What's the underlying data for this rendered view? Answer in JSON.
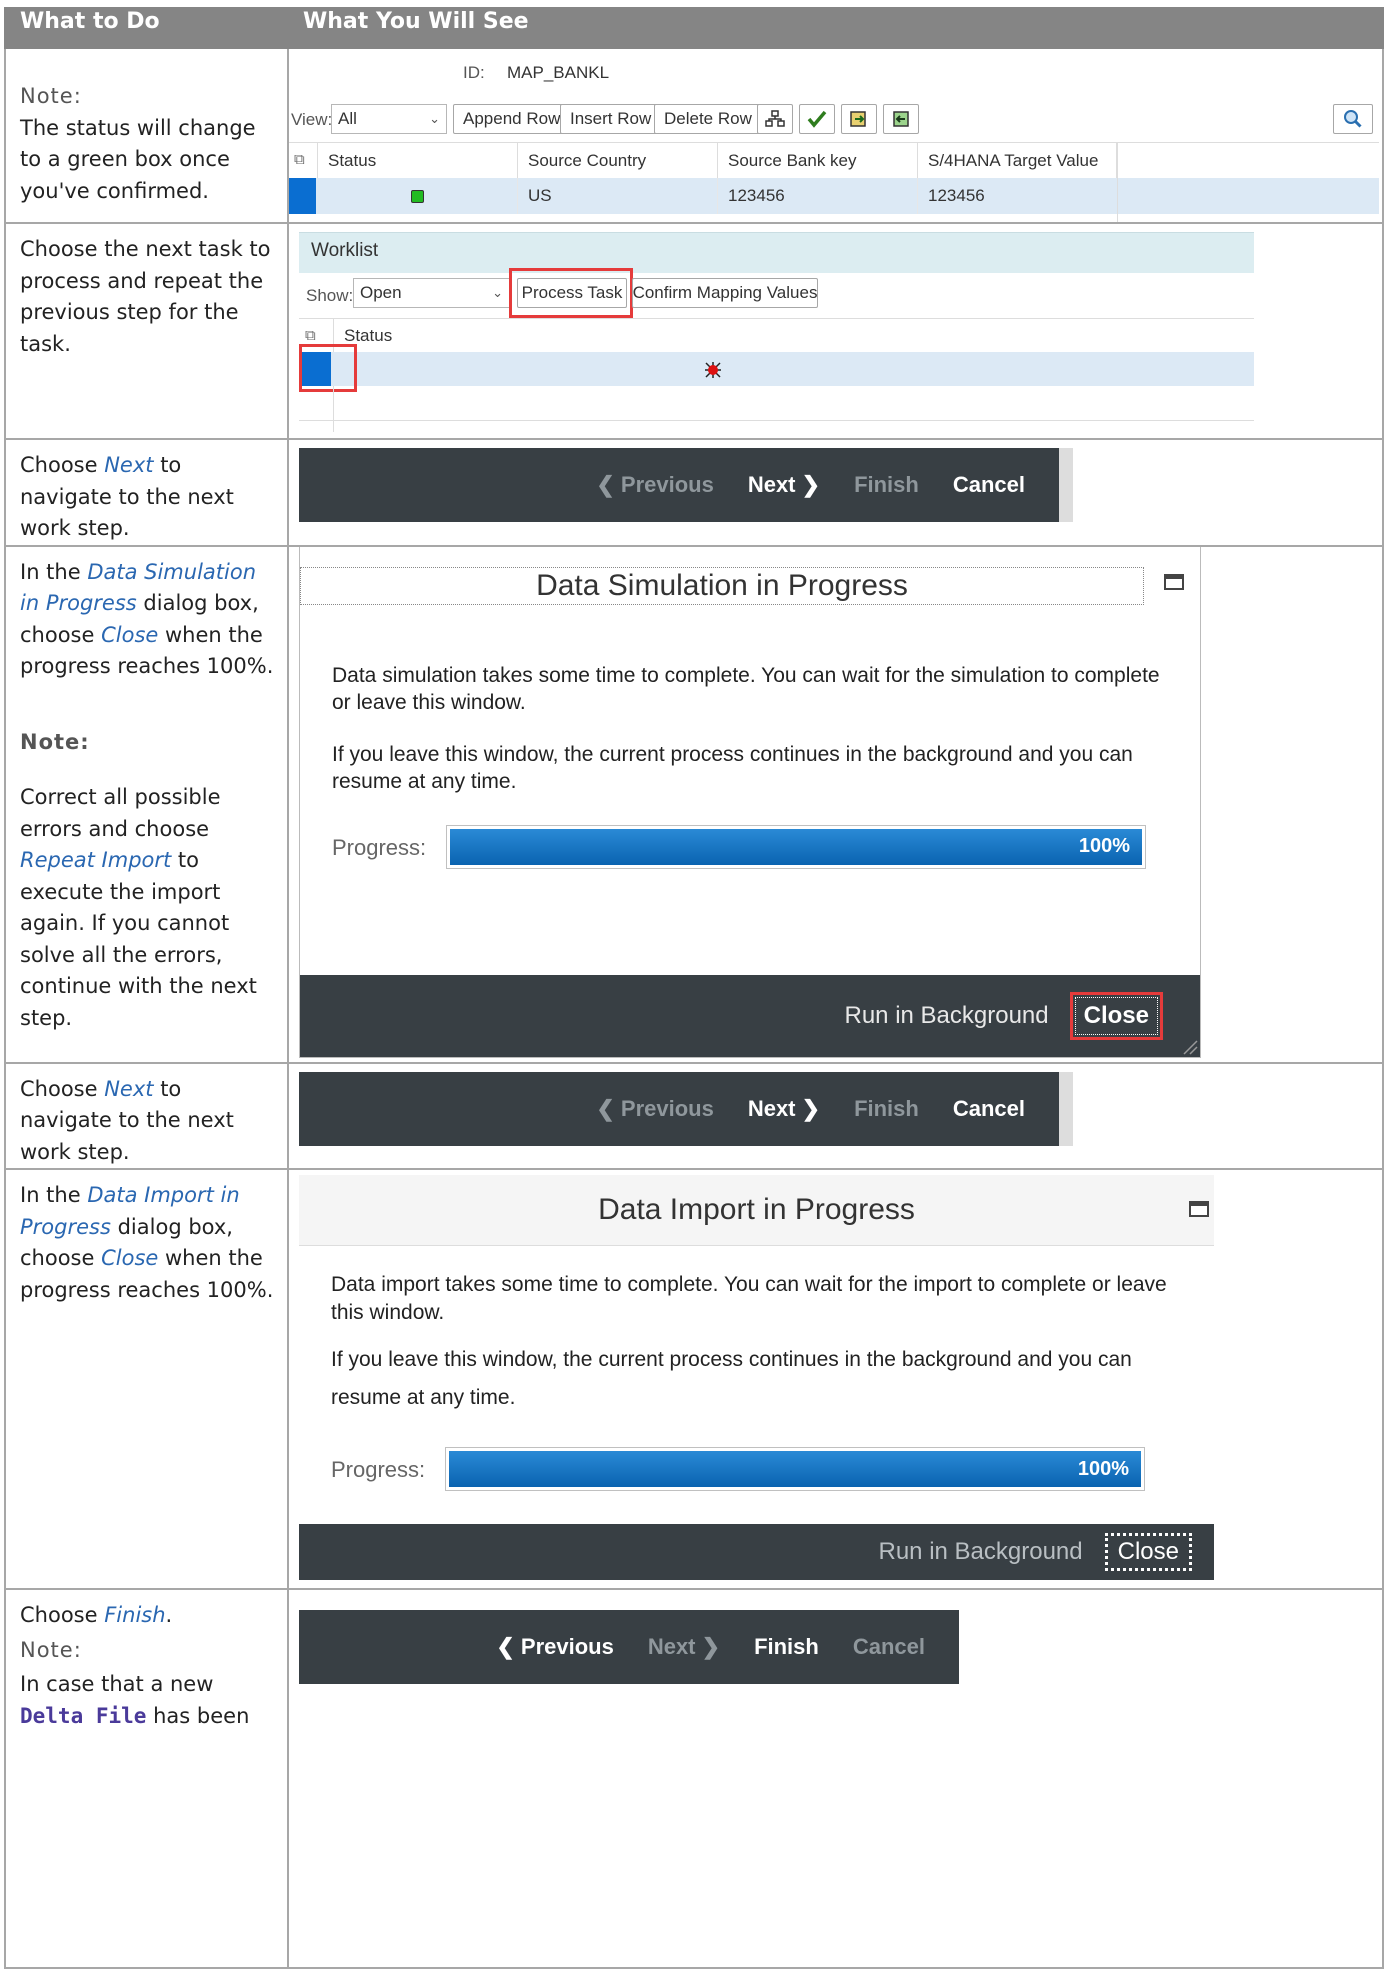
{
  "header": {
    "col1": "What to Do",
    "col2": "What You Will See"
  },
  "rows": {
    "r1": {
      "note_label": "Note:",
      "text": "The status will change to a green box once you've confirmed.",
      "ui": {
        "id_label": "ID:",
        "id_value": "MAP_BANKL",
        "view_label": "View:",
        "view_value": "All",
        "buttons": [
          "Append Row",
          "Insert Row",
          "Delete Row"
        ],
        "columns": [
          "Status",
          "Source Country",
          "Source Bank key",
          "S/4HANA Target Value"
        ],
        "row": {
          "country": "US",
          "bank_key": "123456",
          "target": "123456",
          "status_color": "#22bb22"
        }
      }
    },
    "r2": {
      "text": "Choose the next task to process and repeat the previous step for the task.",
      "ui": {
        "title": "Worklist",
        "show_label": "Show:",
        "show_value": "Open",
        "process_btn": "Process Task",
        "confirm_btn": "Confirm Mapping Values",
        "column": "Status",
        "status_color": "#dd1111"
      }
    },
    "r3": {
      "text_pre": "Choose ",
      "keyword": "Next",
      "text_post": " to navigate to the next work step.",
      "nav": {
        "previous": "Previous",
        "next": "Next",
        "finish": "Finish",
        "cancel": "Cancel"
      }
    },
    "r4": {
      "t1": "In the ",
      "k1": "Data Simulation in Progress",
      "t2": " dialog box, choose ",
      "k2": "Close",
      "t3": " when the progress reaches 100%.",
      "note_label": "Note:",
      "n1": "Correct all possible errors and choose ",
      "nk": "Repeat Import",
      "n2": " to execute the import again. If you cannot solve all the errors, continue with the next step.",
      "dialog": {
        "title": "Data Simulation in Progress",
        "p1": "Data simulation takes some time to complete. You can wait for the simulation to complete or leave this window.",
        "p2": "If you leave this window, the current process continues in the background and you can resume at any time.",
        "progress_label": "Progress:",
        "progress_value": "100%",
        "run_bg": "Run in Background",
        "close": "Close"
      }
    },
    "r5": {
      "text_pre": "Choose ",
      "keyword": "Next",
      "text_post": " to navigate to the next work step.",
      "nav": {
        "previous": "Previous",
        "next": "Next",
        "finish": "Finish",
        "cancel": "Cancel"
      }
    },
    "r6": {
      "t1": "In the ",
      "k1": "Data Import in Progress",
      "t2": " dialog box, choose ",
      "k2": "Close",
      "t3": " when the progress reaches 100%.",
      "dialog": {
        "title": "Data Import in Progress",
        "p1": "Data import takes some time to complete. You can wait for the import to complete or leave this window.",
        "p2": "If you leave this window, the current process continues in the background and you can resume at any time.",
        "progress_label": "Progress:",
        "progress_value": "100%",
        "run_bg": "Run in Background",
        "close": "Close"
      }
    },
    "r7": {
      "text_pre": "Choose ",
      "keyword": "Finish",
      "text_post": ".",
      "note_label": "Note:",
      "n1": "In case that a new ",
      "mono": "Delta File",
      "n2": " has been",
      "nav": {
        "previous": "Previous",
        "next": "Next",
        "finish": "Finish",
        "cancel": "Cancel"
      }
    }
  }
}
